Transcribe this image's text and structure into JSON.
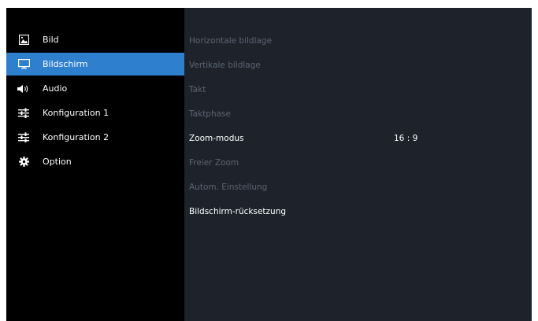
{
  "sidebar": {
    "items": [
      {
        "label": "Bild",
        "icon": "picture-icon"
      },
      {
        "label": "Bildschirm",
        "icon": "monitor-icon",
        "selected": true
      },
      {
        "label": "Audio",
        "icon": "speaker-icon"
      },
      {
        "label": "Konfiguration 1",
        "icon": "sliders-icon"
      },
      {
        "label": "Konfiguration 2",
        "icon": "sliders-icon"
      },
      {
        "label": "Option",
        "icon": "gear-icon"
      }
    ]
  },
  "panel": {
    "rows": [
      {
        "label": "Horizontale bildlage",
        "enabled": false
      },
      {
        "label": "Vertikale bildlage",
        "enabled": false
      },
      {
        "label": "Takt",
        "enabled": false
      },
      {
        "label": "Taktphase",
        "enabled": false
      },
      {
        "label": "Zoom-modus",
        "enabled": true,
        "value": "16 : 9"
      },
      {
        "label": "Freier Zoom",
        "enabled": false
      },
      {
        "label": "Autom. Einstellung",
        "enabled": false
      },
      {
        "label": "Bildschirm-rücksetzung",
        "enabled": true
      }
    ]
  },
  "colors": {
    "sidebar_bg": "#000000",
    "panel_bg": "#1e232b",
    "selection": "#2f7fcf",
    "text_active": "#ffffff",
    "text_disabled": "#5b6472"
  }
}
